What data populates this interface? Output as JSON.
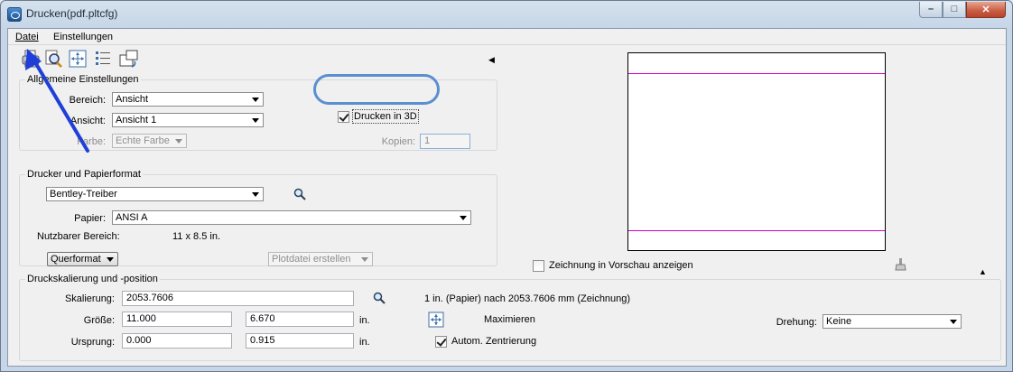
{
  "window": {
    "title": "Drucken(pdf.pltcfg)"
  },
  "menu": {
    "datei": "Datei",
    "einstellungen": "Einstellungen"
  },
  "allgemein": {
    "legend": "Allgemeine Einstellungen",
    "bereich_label": "Bereich:",
    "bereich_value": "Ansicht",
    "ansicht_label": "Ansicht:",
    "ansicht_value": "Ansicht 1",
    "farbe_label": "Farbe:",
    "farbe_value": "Echte Farbe",
    "drucken3d_label": "Drucken in 3D",
    "drucken3d_checked": true,
    "kopien_label": "Kopien:",
    "kopien_value": "1"
  },
  "drucker": {
    "legend": "Drucker und Papierformat",
    "treiber_value": "Bentley-Treiber",
    "papier_label": "Papier:",
    "papier_value": "ANSI A",
    "nutzbar_label": "Nutzbarer Bereich:",
    "nutzbar_value": "11 x 8.5 in.",
    "format_value": "Querformat",
    "plotdatei_value": "Plotdatei erstellen"
  },
  "preview": {
    "zeichnung_label": "Zeichnung in Vorschau anzeigen",
    "zeichnung_checked": false
  },
  "skalierung": {
    "legend": "Druckskalierung und -position",
    "skalierung_label": "Skalierung:",
    "skalierung_value": "2053.7606",
    "scale_note": "1 in. (Papier) nach 2053.7606 mm (Zeichnung)",
    "groesse_label": "Größe:",
    "groesse_x": "11.000",
    "groesse_y": "6.670",
    "groesse_unit": "in.",
    "maximieren_label": "Maximieren",
    "ursprung_label": "Ursprung:",
    "ursprung_x": "0.000",
    "ursprung_y": "0.915",
    "ursprung_unit": "in.",
    "zentrierung_label": "Autom. Zentrierung",
    "zentrierung_checked": true,
    "drehung_label": "Drehung:",
    "drehung_value": "Keine"
  },
  "colors": {
    "annotation_arrow": "#1f3fd8",
    "annotation_ellipse": "#5a8fd0",
    "preview_lines": "#d400d4"
  }
}
